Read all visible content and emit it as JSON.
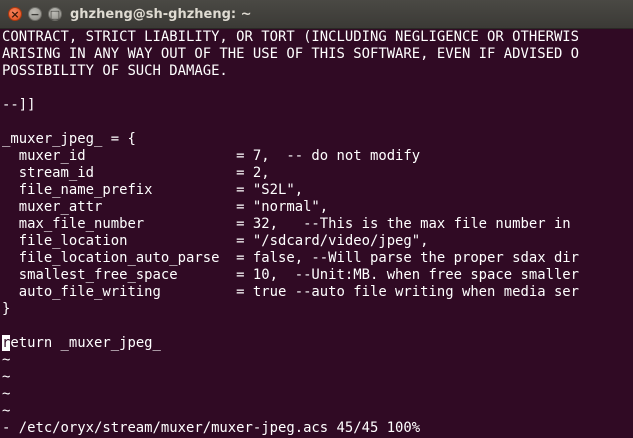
{
  "window": {
    "title": "ghzheng@sh-ghzheng: ~",
    "close_glyph": "×",
    "minimize_glyph": "−",
    "maximize_glyph": "□"
  },
  "terminal": {
    "lines": [
      "CONTRACT, STRICT LIABILITY, OR TORT (INCLUDING NEGLIGENCE OR OTHERWIS",
      "ARISING IN ANY WAY OUT OF THE USE OF THIS SOFTWARE, EVEN IF ADVISED O",
      "POSSIBILITY OF SUCH DAMAGE.",
      "",
      "--]]",
      "",
      "_muxer_jpeg_ = {",
      "  muxer_id                  = 7,  -- do not modify",
      "  stream_id                 = 2,",
      "  file_name_prefix          = \"S2L\",",
      "  muxer_attr                = \"normal\",",
      "  max_file_number           = 32,   --This is the max file number in",
      "  file_location             = \"/sdcard/video/jpeg\",",
      "  file_location_auto_parse  = false, --Will parse the proper sdax dir",
      "  smallest_free_space       = 10,  --Unit:MB. when free space smaller",
      "  auto_file_writing         = true --auto file writing when media ser",
      "}",
      ""
    ],
    "cursor_line": {
      "cursor_char": "r",
      "rest": "eturn _muxer_jpeg_"
    },
    "empty_line_markers": [
      "~",
      "~",
      "~",
      "~"
    ],
    "status_line": "- /etc/oryx/stream/muxer/muxer-jpeg.acs 45/45 100%"
  }
}
